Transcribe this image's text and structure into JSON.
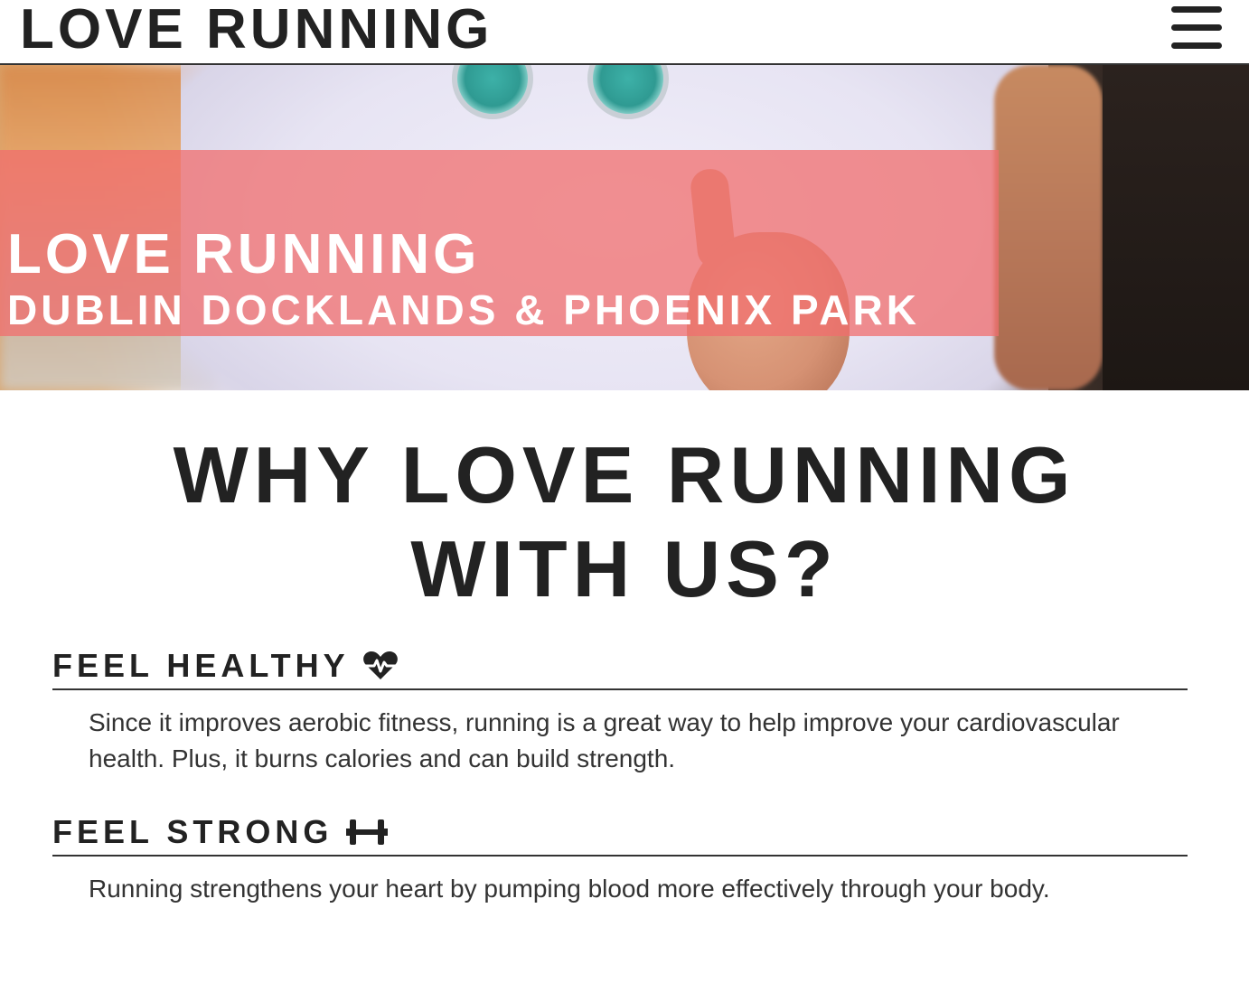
{
  "header": {
    "logo": "LOVE RUNNING",
    "menu_icon": "hamburger-menu-icon"
  },
  "hero": {
    "title": "LOVE RUNNING",
    "subtitle": "DUBLIN DOCKLANDS & PHOENIX PARK",
    "band_color": "#f06e6e"
  },
  "main": {
    "heading_line1": "WHY LOVE RUNNING",
    "heading_line2": "WITH US?",
    "features": [
      {
        "title": "FEEL HEALTHY",
        "icon": "heartbeat-icon",
        "text": "Since it improves aerobic fitness, running is a great way to help improve your cardiovascular health. Plus, it burns calories and can build strength."
      },
      {
        "title": "FEEL STRONG",
        "icon": "dumbbell-icon",
        "text": "Running strengthens your heart by pumping blood more effectively through your body."
      }
    ]
  }
}
